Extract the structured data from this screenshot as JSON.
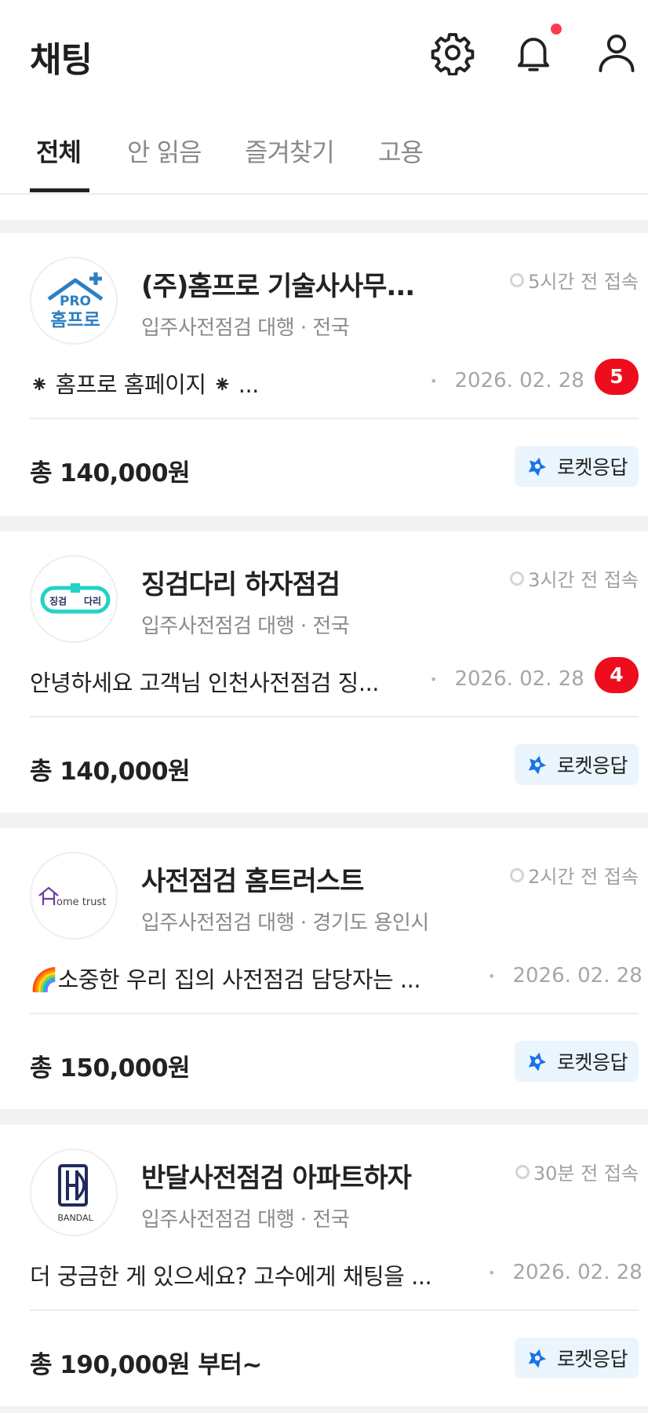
{
  "header": {
    "title": "채팅",
    "icons": [
      "gear-icon",
      "bell-icon",
      "user-icon"
    ],
    "has_notification_dot": true
  },
  "tabs": [
    {
      "label": "전체",
      "active": true
    },
    {
      "label": "안 읽음",
      "active": false
    },
    {
      "label": "즐겨찾기",
      "active": false
    },
    {
      "label": "고용",
      "active": false
    }
  ],
  "colors": {
    "badge_red": "#ee0d1c",
    "rocket_bg": "#eaf5fd",
    "rocket_icon": "#1a73e8",
    "separator": "#f2f3f5"
  },
  "chats": [
    {
      "name": "(주)홈프로 기술사사무...",
      "last_seen": "5시간 전 접속",
      "subtitle": "입주사전점검 대행 · 전국",
      "message": "⁕ 홈프로 홈페이지 ⁕ ...",
      "date": "2026. 02. 28",
      "unread": "5",
      "price": "총 140,000원",
      "tag": "로켓응답",
      "avatar_logo": {
        "top": "PRO",
        "bottom": "홈프로"
      }
    },
    {
      "name": "징검다리 하자점검",
      "last_seen": "3시간 전 접속",
      "subtitle": "입주사전점검 대행 · 전국",
      "message": "안녕하세요 고객님 인천사전점검 징...",
      "date": "2026. 02. 28",
      "unread": "4",
      "price": "총 140,000원",
      "tag": "로켓응답",
      "avatar_logo": {
        "left": "징검",
        "right": "다리"
      }
    },
    {
      "name": "사전점검 홈트러스트",
      "last_seen": "2시간 전 접속",
      "subtitle": "입주사전점검 대행 · 경기도 용인시",
      "message": "🌈소중한 우리 집의 사전점검 담당자는 ...",
      "date": "2026. 02. 28",
      "unread": "",
      "price": "총 150,000원",
      "tag": "로켓응답",
      "avatar_logo": {
        "text": "ome trust"
      }
    },
    {
      "name": "반달사전점검 아파트하자",
      "last_seen": "30분 전 접속",
      "subtitle": "입주사전점검 대행 · 전국",
      "message": "더 궁금한 게 있으세요? 고수에게 채팅을 ...",
      "date": "2026. 02. 28",
      "unread": "",
      "price": "총 190,000원 부터~",
      "tag": "로켓응답",
      "avatar_logo": {
        "text": "BANDAL"
      }
    }
  ]
}
